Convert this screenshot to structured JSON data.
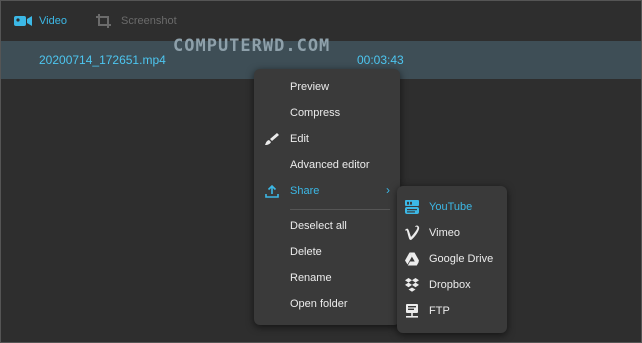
{
  "tabs": {
    "video_label": "Video",
    "video_icon": "video-camera-icon",
    "screenshot_label": "Screenshot",
    "screenshot_icon": "crop-icon"
  },
  "file_row": {
    "name": "20200714_172651.mp4",
    "duration": "00:03:43"
  },
  "watermark": "COMPUTERWD.COM",
  "context_menu": {
    "items": [
      {
        "label": "Preview"
      },
      {
        "label": "Compress"
      },
      {
        "label": "Edit",
        "icon": "brush-icon"
      },
      {
        "label": "Advanced editor"
      },
      {
        "label": "Share",
        "icon": "upload-icon",
        "submenu": true
      },
      {
        "label": "Deselect all"
      },
      {
        "label": "Delete"
      },
      {
        "label": "Rename"
      },
      {
        "label": "Open folder"
      }
    ]
  },
  "share_menu": {
    "items": [
      {
        "label": "YouTube",
        "icon": "youtube-icon"
      },
      {
        "label": "Vimeo",
        "icon": "vimeo-icon"
      },
      {
        "label": "Google Drive",
        "icon": "google-drive-icon"
      },
      {
        "label": "Dropbox",
        "icon": "dropbox-icon"
      },
      {
        "label": "FTP",
        "icon": "ftp-icon"
      }
    ]
  },
  "colors": {
    "accent": "#3cb8e6",
    "row_bg": "#3e4e56",
    "menu_bg": "#3a3a3a",
    "background": "#2e2e2e"
  }
}
